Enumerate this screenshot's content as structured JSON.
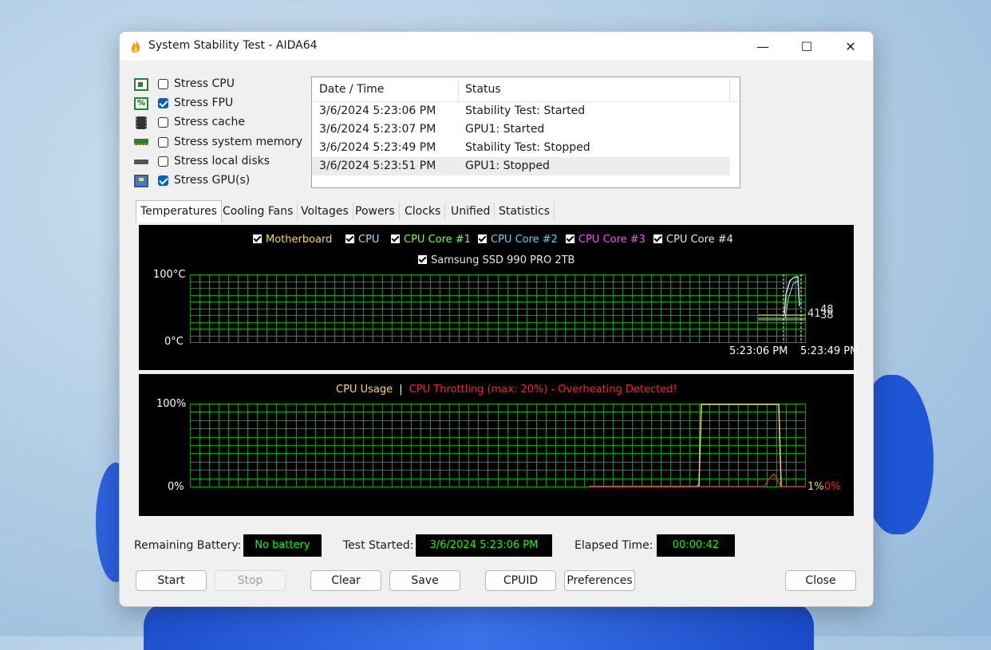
{
  "window": {
    "title": "System Stability Test - AIDA64",
    "controls": {
      "minimize": "—",
      "maximize": "☐",
      "close": "✕"
    }
  },
  "stress_options": [
    {
      "label": "Stress CPU",
      "checked": false,
      "icon": "cpu-icon"
    },
    {
      "label": "Stress FPU",
      "checked": true,
      "icon": "fpu-icon"
    },
    {
      "label": "Stress cache",
      "checked": false,
      "icon": "cache-icon"
    },
    {
      "label": "Stress system memory",
      "checked": false,
      "icon": "memory-icon"
    },
    {
      "label": "Stress local disks",
      "checked": false,
      "icon": "disk-icon"
    },
    {
      "label": "Stress GPU(s)",
      "checked": true,
      "icon": "gpu-icon"
    }
  ],
  "log": {
    "headers": [
      "Date / Time",
      "Status"
    ],
    "rows": [
      {
        "time": "3/6/2024 5:23:06 PM",
        "status": "Stability Test: Started"
      },
      {
        "time": "3/6/2024 5:23:07 PM",
        "status": "GPU1: Started"
      },
      {
        "time": "3/6/2024 5:23:49 PM",
        "status": "Stability Test: Stopped"
      },
      {
        "time": "3/6/2024 5:23:51 PM",
        "status": "GPU1: Stopped"
      }
    ]
  },
  "tabs": [
    "Temperatures",
    "Cooling Fans",
    "Voltages",
    "Powers",
    "Clocks",
    "Unified",
    "Statistics"
  ],
  "active_tab": "Temperatures",
  "temp_chart": {
    "legend": [
      {
        "label": "Motherboard",
        "color": "#ffd84a"
      },
      {
        "label": "CPU",
        "color": "#9fe0ff"
      },
      {
        "label": "CPU Core #1",
        "color": "#7cff4a"
      },
      {
        "label": "CPU Core #2",
        "color": "#4ad8ff"
      },
      {
        "label": "CPU Core #3",
        "color": "#ff4aff"
      },
      {
        "label": "CPU Core #4",
        "color": "#e8e8e8"
      },
      {
        "label": "Samsung SSD 990 PRO 2TB",
        "color": "#e8e8e8"
      }
    ],
    "y_top": "100°C",
    "y_bottom": "0°C",
    "x_labels": [
      "5:23:06 PM",
      "5:23:49 PM"
    ],
    "current_values": [
      "41",
      "38",
      "48"
    ],
    "grid_color": "#00a000"
  },
  "cpu_chart": {
    "title_usage": "CPU Usage",
    "separator": "|",
    "title_throttle": "CPU Throttling (max: 20%) - Overheating Detected!",
    "usage_color": "#ffd84a",
    "throttle_color": "#ff2020",
    "y_top": "100%",
    "y_bottom": "0%",
    "usage_value": "1%",
    "throttle_value": "0%"
  },
  "status": {
    "battery_label": "Remaining Battery:",
    "battery_value": "No battery",
    "started_label": "Test Started:",
    "started_value": "3/6/2024 5:23:06 PM",
    "elapsed_label": "Elapsed Time:",
    "elapsed_value": "00:00:42"
  },
  "buttons": {
    "start": "Start",
    "stop": "Stop",
    "clear": "Clear",
    "save": "Save",
    "cpuid": "CPUID",
    "preferences": "Preferences",
    "close": "Close"
  }
}
